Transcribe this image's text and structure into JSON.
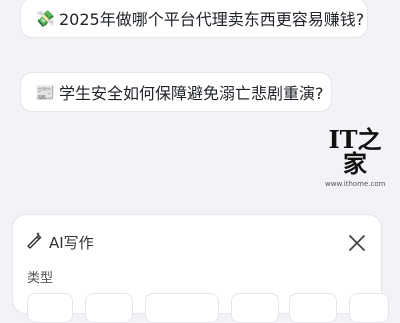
{
  "suggestions": [
    {
      "emoji": "💸",
      "icon": "money-with-wings-icon",
      "text": "2025年做哪个平台代理卖东西更容易赚钱?"
    },
    {
      "emoji": "📰",
      "icon": "newspaper-icon",
      "text": "学生安全如何保障避免溺亡悲剧重演?"
    }
  ],
  "watermark": {
    "logo": "IT之家",
    "url": "www.ithome.com"
  },
  "panel": {
    "title": "AI写作",
    "title_icon": "ai-pen-icon",
    "close_icon": "close-icon",
    "type_label": "类型",
    "type_chip_count": 6
  }
}
